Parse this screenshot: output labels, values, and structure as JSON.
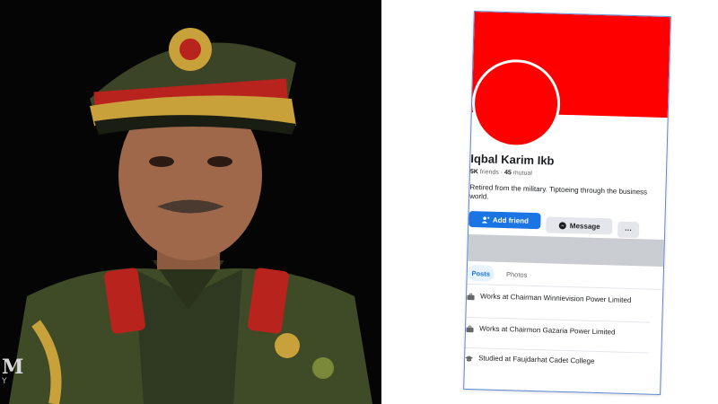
{
  "photo": {
    "watermark": "M",
    "watermark_sub": "Y"
  },
  "profile": {
    "name": "Iqbal Karim Ikb",
    "friends": "5K",
    "friends_label": "friends",
    "separator": "·",
    "mutual": "45",
    "mutual_label": "mutual",
    "bio": "Retired from the military. Tiptoeing through the business world.",
    "cover_color": "#ff0000",
    "avatar_color": "#ff0000"
  },
  "actions": {
    "add_friend_label": "Add friend",
    "message_label": "Message",
    "more_label": "···"
  },
  "tabs": [
    {
      "label": "Posts",
      "active": true
    },
    {
      "label": "Photos",
      "active": false
    }
  ],
  "intro": [
    {
      "icon": "briefcase-icon",
      "text": "Works at Chairman Winnievision Power Limited"
    },
    {
      "icon": "briefcase-icon",
      "text": "Works at Chairmon Gazaria Power Limited"
    },
    {
      "icon": "graduation-cap-icon",
      "text": "Studied at Faujdarhat Cadet College"
    }
  ],
  "colors": {
    "accent": "#1b74e4",
    "screenshot_border": "#5b86d6"
  }
}
